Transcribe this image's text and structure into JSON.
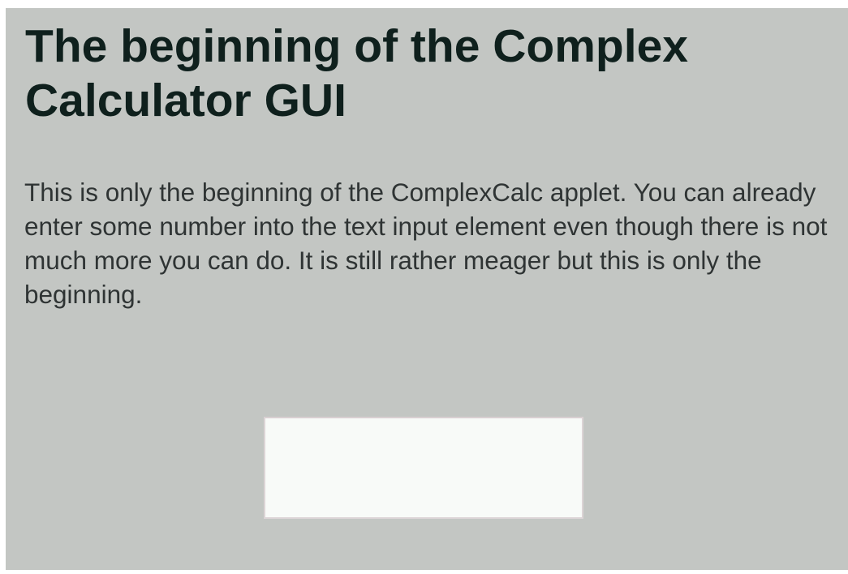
{
  "applet": {
    "title": "The beginning of the Complex Calculator GUI",
    "description": "This is only the beginning of the ComplexCalc applet. You can already enter some number into the text input element even though there is not much more you can do. It is still rather meager but this is only the beginning.",
    "input": {
      "value": "",
      "placeholder": ""
    }
  },
  "colors": {
    "background": "#c3c6c3",
    "title": "#0f201d",
    "text": "#2f3434",
    "input_background": "#f8faf8"
  }
}
